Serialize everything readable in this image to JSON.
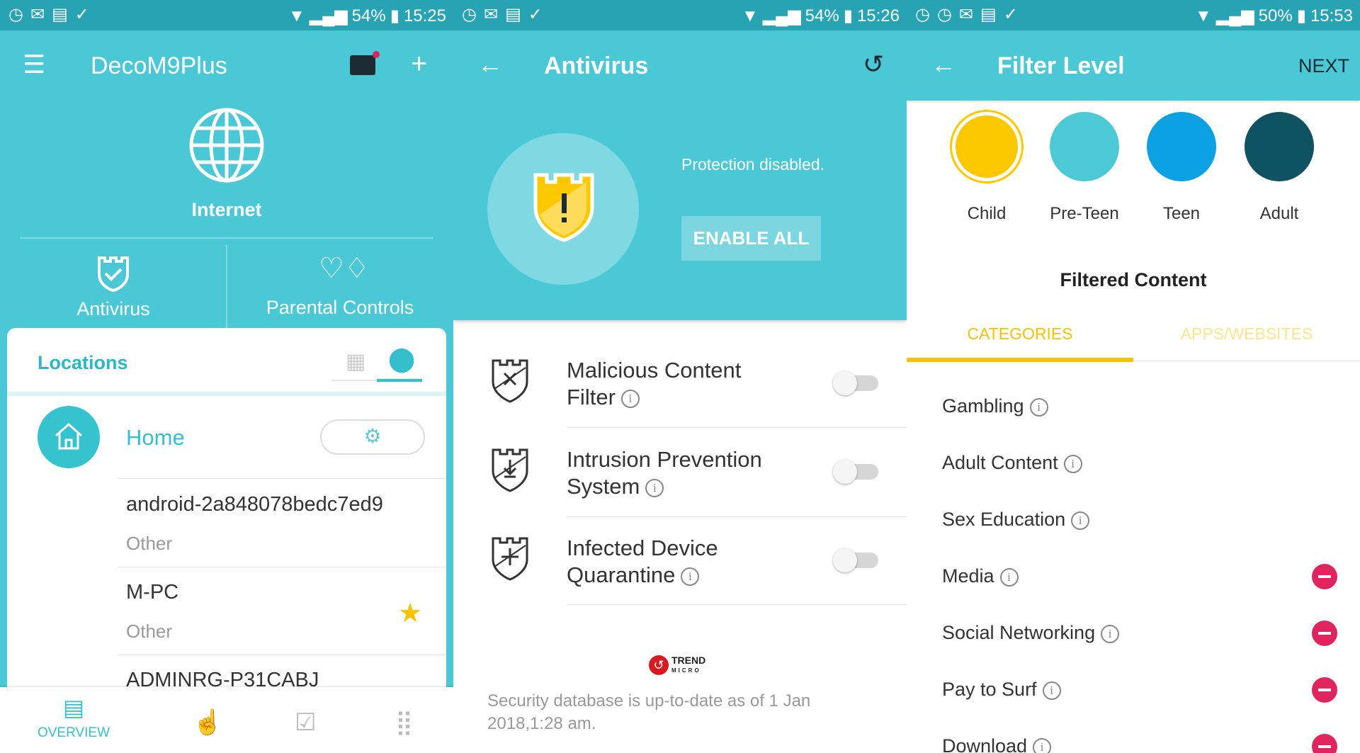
{
  "panels": [
    {
      "status": {
        "battery": "54%",
        "time": "15:25"
      },
      "header": {
        "title": "DecoM9Plus",
        "menu_icon": "hamburger-icon",
        "mail_icon": "mail-icon",
        "add_icon": "plus-icon"
      },
      "internet": {
        "label": "Internet",
        "icon": "globe-icon"
      },
      "shortcuts": [
        {
          "label": "Antivirus",
          "icon": "shield-check-icon"
        },
        {
          "label": "Parental Controls",
          "icon": "family-icon"
        }
      ],
      "locations": {
        "title": "Locations",
        "home": "Home",
        "devices": [
          {
            "name": "android-2a848078bedc7ed9",
            "type": "Other"
          },
          {
            "name": "M-PC",
            "type": "Other",
            "starred": true
          },
          {
            "name": "ADMINRG-P31CABJ"
          }
        ]
      },
      "bottom_nav": {
        "active": "OVERVIEW"
      }
    },
    {
      "status": {
        "battery": "54%",
        "time": "15:26"
      },
      "header": {
        "title": "Antivirus"
      },
      "protection": {
        "status": "Protection disabled.",
        "button": "ENABLE ALL"
      },
      "features": [
        {
          "line1": "Malicious Content",
          "line2": "Filter",
          "enabled": false
        },
        {
          "line1": "Intrusion Prevention",
          "line2": "System",
          "enabled": false
        },
        {
          "line1": "Infected Device",
          "line2": "Quarantine",
          "enabled": false
        }
      ],
      "vendor": "TREND MICRO",
      "db_status_1": "Security database is up-to-date as of 1 Jan",
      "db_status_2": "2018,1:28 am."
    },
    {
      "status": {
        "battery": "50%",
        "time": "15:53"
      },
      "header": {
        "title": "Filter Level",
        "next": "NEXT"
      },
      "levels": [
        {
          "label": "Child",
          "color": "#fdc800",
          "selected": true
        },
        {
          "label": "Pre-Teen",
          "color": "#4dc9d6"
        },
        {
          "label": "Teen",
          "color": "#0ba1e2"
        },
        {
          "label": "Adult",
          "color": "#0f5262"
        }
      ],
      "section_title": "Filtered Content",
      "tabs": [
        "CATEGORIES",
        "APPS/WEBSITES"
      ],
      "categories": [
        {
          "label": "Gambling",
          "blocked": false
        },
        {
          "label": "Adult Content",
          "blocked": false
        },
        {
          "label": "Sex Education",
          "blocked": false
        },
        {
          "label": "Media",
          "blocked": true
        },
        {
          "label": "Social Networking",
          "blocked": true
        },
        {
          "label": "Pay to Surf",
          "blocked": true
        },
        {
          "label": "Download",
          "blocked": true
        }
      ]
    }
  ],
  "colors": {
    "teal": "#4ac8d5",
    "status_bar": "#27a3b3",
    "yellow": "#f5c300",
    "red": "#e0245e"
  }
}
